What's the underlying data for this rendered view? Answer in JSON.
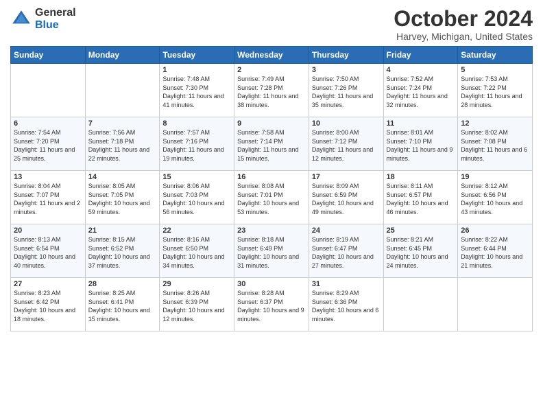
{
  "header": {
    "logo_general": "General",
    "logo_blue": "Blue",
    "month_title": "October 2024",
    "location": "Harvey, Michigan, United States"
  },
  "days_of_week": [
    "Sunday",
    "Monday",
    "Tuesday",
    "Wednesday",
    "Thursday",
    "Friday",
    "Saturday"
  ],
  "weeks": [
    [
      {
        "day": "",
        "info": ""
      },
      {
        "day": "",
        "info": ""
      },
      {
        "day": "1",
        "info": "Sunrise: 7:48 AM\nSunset: 7:30 PM\nDaylight: 11 hours and 41 minutes."
      },
      {
        "day": "2",
        "info": "Sunrise: 7:49 AM\nSunset: 7:28 PM\nDaylight: 11 hours and 38 minutes."
      },
      {
        "day": "3",
        "info": "Sunrise: 7:50 AM\nSunset: 7:26 PM\nDaylight: 11 hours and 35 minutes."
      },
      {
        "day": "4",
        "info": "Sunrise: 7:52 AM\nSunset: 7:24 PM\nDaylight: 11 hours and 32 minutes."
      },
      {
        "day": "5",
        "info": "Sunrise: 7:53 AM\nSunset: 7:22 PM\nDaylight: 11 hours and 28 minutes."
      }
    ],
    [
      {
        "day": "6",
        "info": "Sunrise: 7:54 AM\nSunset: 7:20 PM\nDaylight: 11 hours and 25 minutes."
      },
      {
        "day": "7",
        "info": "Sunrise: 7:56 AM\nSunset: 7:18 PM\nDaylight: 11 hours and 22 minutes."
      },
      {
        "day": "8",
        "info": "Sunrise: 7:57 AM\nSunset: 7:16 PM\nDaylight: 11 hours and 19 minutes."
      },
      {
        "day": "9",
        "info": "Sunrise: 7:58 AM\nSunset: 7:14 PM\nDaylight: 11 hours and 15 minutes."
      },
      {
        "day": "10",
        "info": "Sunrise: 8:00 AM\nSunset: 7:12 PM\nDaylight: 11 hours and 12 minutes."
      },
      {
        "day": "11",
        "info": "Sunrise: 8:01 AM\nSunset: 7:10 PM\nDaylight: 11 hours and 9 minutes."
      },
      {
        "day": "12",
        "info": "Sunrise: 8:02 AM\nSunset: 7:08 PM\nDaylight: 11 hours and 6 minutes."
      }
    ],
    [
      {
        "day": "13",
        "info": "Sunrise: 8:04 AM\nSunset: 7:07 PM\nDaylight: 11 hours and 2 minutes."
      },
      {
        "day": "14",
        "info": "Sunrise: 8:05 AM\nSunset: 7:05 PM\nDaylight: 10 hours and 59 minutes."
      },
      {
        "day": "15",
        "info": "Sunrise: 8:06 AM\nSunset: 7:03 PM\nDaylight: 10 hours and 56 minutes."
      },
      {
        "day": "16",
        "info": "Sunrise: 8:08 AM\nSunset: 7:01 PM\nDaylight: 10 hours and 53 minutes."
      },
      {
        "day": "17",
        "info": "Sunrise: 8:09 AM\nSunset: 6:59 PM\nDaylight: 10 hours and 49 minutes."
      },
      {
        "day": "18",
        "info": "Sunrise: 8:11 AM\nSunset: 6:57 PM\nDaylight: 10 hours and 46 minutes."
      },
      {
        "day": "19",
        "info": "Sunrise: 8:12 AM\nSunset: 6:56 PM\nDaylight: 10 hours and 43 minutes."
      }
    ],
    [
      {
        "day": "20",
        "info": "Sunrise: 8:13 AM\nSunset: 6:54 PM\nDaylight: 10 hours and 40 minutes."
      },
      {
        "day": "21",
        "info": "Sunrise: 8:15 AM\nSunset: 6:52 PM\nDaylight: 10 hours and 37 minutes."
      },
      {
        "day": "22",
        "info": "Sunrise: 8:16 AM\nSunset: 6:50 PM\nDaylight: 10 hours and 34 minutes."
      },
      {
        "day": "23",
        "info": "Sunrise: 8:18 AM\nSunset: 6:49 PM\nDaylight: 10 hours and 31 minutes."
      },
      {
        "day": "24",
        "info": "Sunrise: 8:19 AM\nSunset: 6:47 PM\nDaylight: 10 hours and 27 minutes."
      },
      {
        "day": "25",
        "info": "Sunrise: 8:21 AM\nSunset: 6:45 PM\nDaylight: 10 hours and 24 minutes."
      },
      {
        "day": "26",
        "info": "Sunrise: 8:22 AM\nSunset: 6:44 PM\nDaylight: 10 hours and 21 minutes."
      }
    ],
    [
      {
        "day": "27",
        "info": "Sunrise: 8:23 AM\nSunset: 6:42 PM\nDaylight: 10 hours and 18 minutes."
      },
      {
        "day": "28",
        "info": "Sunrise: 8:25 AM\nSunset: 6:41 PM\nDaylight: 10 hours and 15 minutes."
      },
      {
        "day": "29",
        "info": "Sunrise: 8:26 AM\nSunset: 6:39 PM\nDaylight: 10 hours and 12 minutes."
      },
      {
        "day": "30",
        "info": "Sunrise: 8:28 AM\nSunset: 6:37 PM\nDaylight: 10 hours and 9 minutes."
      },
      {
        "day": "31",
        "info": "Sunrise: 8:29 AM\nSunset: 6:36 PM\nDaylight: 10 hours and 6 minutes."
      },
      {
        "day": "",
        "info": ""
      },
      {
        "day": "",
        "info": ""
      }
    ]
  ]
}
